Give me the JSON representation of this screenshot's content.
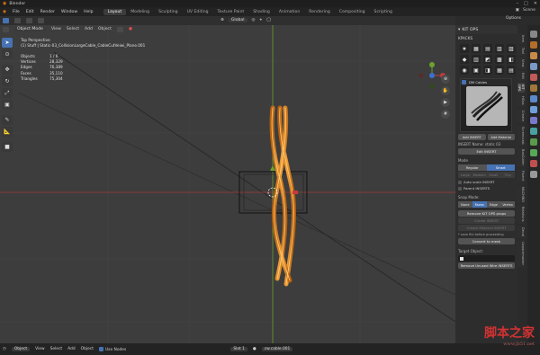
{
  "app": {
    "title": "Blender"
  },
  "menu": {
    "items": [
      "File",
      "Edit",
      "Render",
      "Window",
      "Help"
    ]
  },
  "workspaces": {
    "tabs": [
      "Layout",
      "Modeling",
      "Sculpting",
      "UV Editing",
      "Texture Paint",
      "Shading",
      "Animation",
      "Rendering",
      "Compositing",
      "Scripting"
    ],
    "active": "Layout"
  },
  "scene": {
    "label": "Scene"
  },
  "header": {
    "mode": "Object Mode",
    "view": "View",
    "select": "Select",
    "add": "Add",
    "object": "Object",
    "transform": "Global",
    "options": "Options"
  },
  "viewport": {
    "perspective": "Top Perspective",
    "collection": "(1) Stuff | Static-03_CollisionLargeCable_CableCutVeiwi_Plane.001",
    "stats": [
      {
        "label": "Objects",
        "value": "1 / 6"
      },
      {
        "label": "Vertices",
        "value": "28,329"
      },
      {
        "label": "Edges",
        "value": "76,389"
      },
      {
        "label": "Faces",
        "value": "35,110"
      },
      {
        "label": "Triangles",
        "value": "75,304"
      }
    ]
  },
  "panel": {
    "title": "KIT OPS",
    "section": "KPACKS",
    "insert_name": "DM Cables",
    "insert_label": "INSERT Name: static 03",
    "add_insert": "Add INSERT",
    "add_material": "Add Material",
    "edit_insert": "Edit INSERT",
    "mode_label": "Mode",
    "mode_options": [
      "Regular",
      "Smart"
    ],
    "mode_selected": "Smart",
    "scale_options": [
      "Large",
      "Medium",
      "Small",
      "Tiny"
    ],
    "auto_scale": "Auto scale INSERT",
    "parent_insert": "Parent INSERTS",
    "snap_label": "Snap Mode:",
    "snap_options": [
      "None",
      "Faces",
      "Edge",
      "Vertex"
    ],
    "snap_selected": "Faces",
    "remove_props": "Remove KIT OPS props",
    "create_insert": "Create INSERT",
    "create_material": "Create Material INSERT",
    "save_note": "* save file before proceeding",
    "convert_mesh": "Convert to mesh",
    "target_label": "Target Object:",
    "remove_unused": "Remove Unused Wire INSERTS",
    "tabs": [
      "Item",
      "Tool",
      "View",
      "Edit",
      "KIT OPS",
      "HOps",
      "Create",
      "Screencast",
      "BoxCutter",
      "Fluent",
      "MACHIN3",
      "Relations",
      "Decal",
      "Uvpackmaster"
    ],
    "active_tab": "KIT OPS"
  },
  "status": {
    "object": "Object",
    "view": "View",
    "select": "Select",
    "add": "Add",
    "object2": "Object",
    "use_nodes": "Use Nodes",
    "slot": "Slot 1",
    "material": "cw.cable.001"
  },
  "watermark": {
    "text": "脚本之家",
    "url": "www.jb51.net"
  },
  "colors": {
    "accent": "#4772b3",
    "selection": "#f0a030",
    "x_axis": "#c33b3b",
    "y_axis": "#6ea12a"
  }
}
